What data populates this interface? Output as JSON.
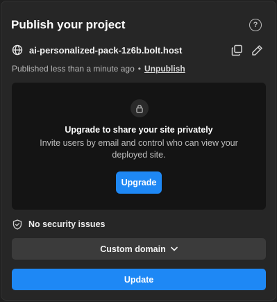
{
  "header": {
    "title": "Publish your project",
    "help_icon": "question-circle-icon",
    "help_glyph": "?"
  },
  "site": {
    "url": "ai-personalized-pack-1z6b.bolt.host",
    "globe_icon": "globe-icon",
    "copy_icon": "copy-icon",
    "edit_icon": "pencil-icon"
  },
  "status": {
    "published_text": "Published less than a minute ago",
    "separator": "•",
    "unpublish_label": "Unpublish"
  },
  "upgrade": {
    "lock_icon": "lock-icon",
    "title": "Upgrade to share your site privately",
    "description": "Invite users by email and control who can view your deployed site.",
    "button_label": "Upgrade"
  },
  "security": {
    "shield_icon": "shield-check-icon",
    "label": "No security issues"
  },
  "custom_domain": {
    "label": "Custom domain",
    "chevron_icon": "chevron-down-icon"
  },
  "update": {
    "label": "Update"
  },
  "colors": {
    "background": "#262626",
    "accent": "#1e88f5",
    "upgrade_box": "#141414",
    "custom_domain_bg": "#3b3b3b"
  }
}
